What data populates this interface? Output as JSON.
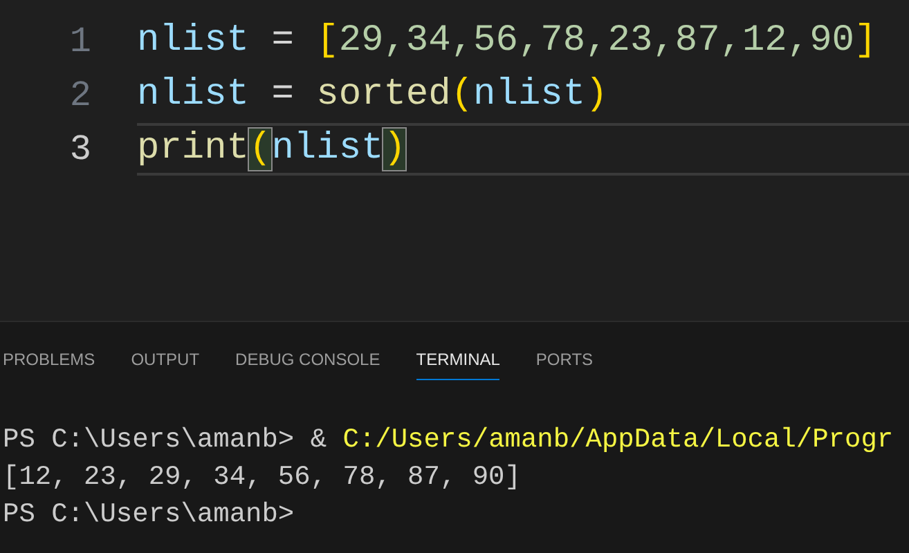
{
  "editor": {
    "lines": [
      {
        "number": "1",
        "current": false,
        "tokens": [
          {
            "text": "nlist",
            "kind": "variable",
            "matched": false
          },
          {
            "text": " = ",
            "kind": "operator",
            "matched": false
          },
          {
            "text": "[",
            "kind": "bracket",
            "matched": false
          },
          {
            "text": "29,34,56,78,23,87,12,90",
            "kind": "number",
            "matched": false
          },
          {
            "text": "]",
            "kind": "bracket",
            "matched": false
          }
        ]
      },
      {
        "number": "2",
        "current": false,
        "tokens": [
          {
            "text": "nlist",
            "kind": "variable",
            "matched": false
          },
          {
            "text": " = ",
            "kind": "operator",
            "matched": false
          },
          {
            "text": "sorted",
            "kind": "function",
            "matched": false
          },
          {
            "text": "(",
            "kind": "bracket",
            "matched": false
          },
          {
            "text": "nlist",
            "kind": "variable",
            "matched": false
          },
          {
            "text": ")",
            "kind": "bracket",
            "matched": false
          }
        ]
      },
      {
        "number": "3",
        "current": true,
        "tokens": [
          {
            "text": "print",
            "kind": "function",
            "matched": false
          },
          {
            "text": "(",
            "kind": "bracket",
            "matched": true
          },
          {
            "text": "nlist",
            "kind": "variable",
            "matched": false
          },
          {
            "text": ")",
            "kind": "bracket",
            "matched": true
          }
        ]
      }
    ]
  },
  "panel": {
    "tabs": [
      {
        "label": "PROBLEMS",
        "selected": false
      },
      {
        "label": "OUTPUT",
        "selected": false
      },
      {
        "label": "DEBUG CONSOLE",
        "selected": false
      },
      {
        "label": "TERMINAL",
        "selected": true
      },
      {
        "label": "PORTS",
        "selected": false
      }
    ],
    "terminal": [
      {
        "segments": [
          {
            "text": "PS C:\\Users\\amanb> & ",
            "kind": "plain"
          },
          {
            "text": "C:/Users/amanb/AppData/Local/Progr",
            "kind": "path"
          }
        ]
      },
      {
        "segments": [
          {
            "text": "[12, 23, 29, 34, 56, 78, 87, 90]",
            "kind": "plain"
          }
        ]
      },
      {
        "segments": [
          {
            "text": "PS C:\\Users\\amanb>",
            "kind": "plain"
          }
        ]
      }
    ]
  }
}
